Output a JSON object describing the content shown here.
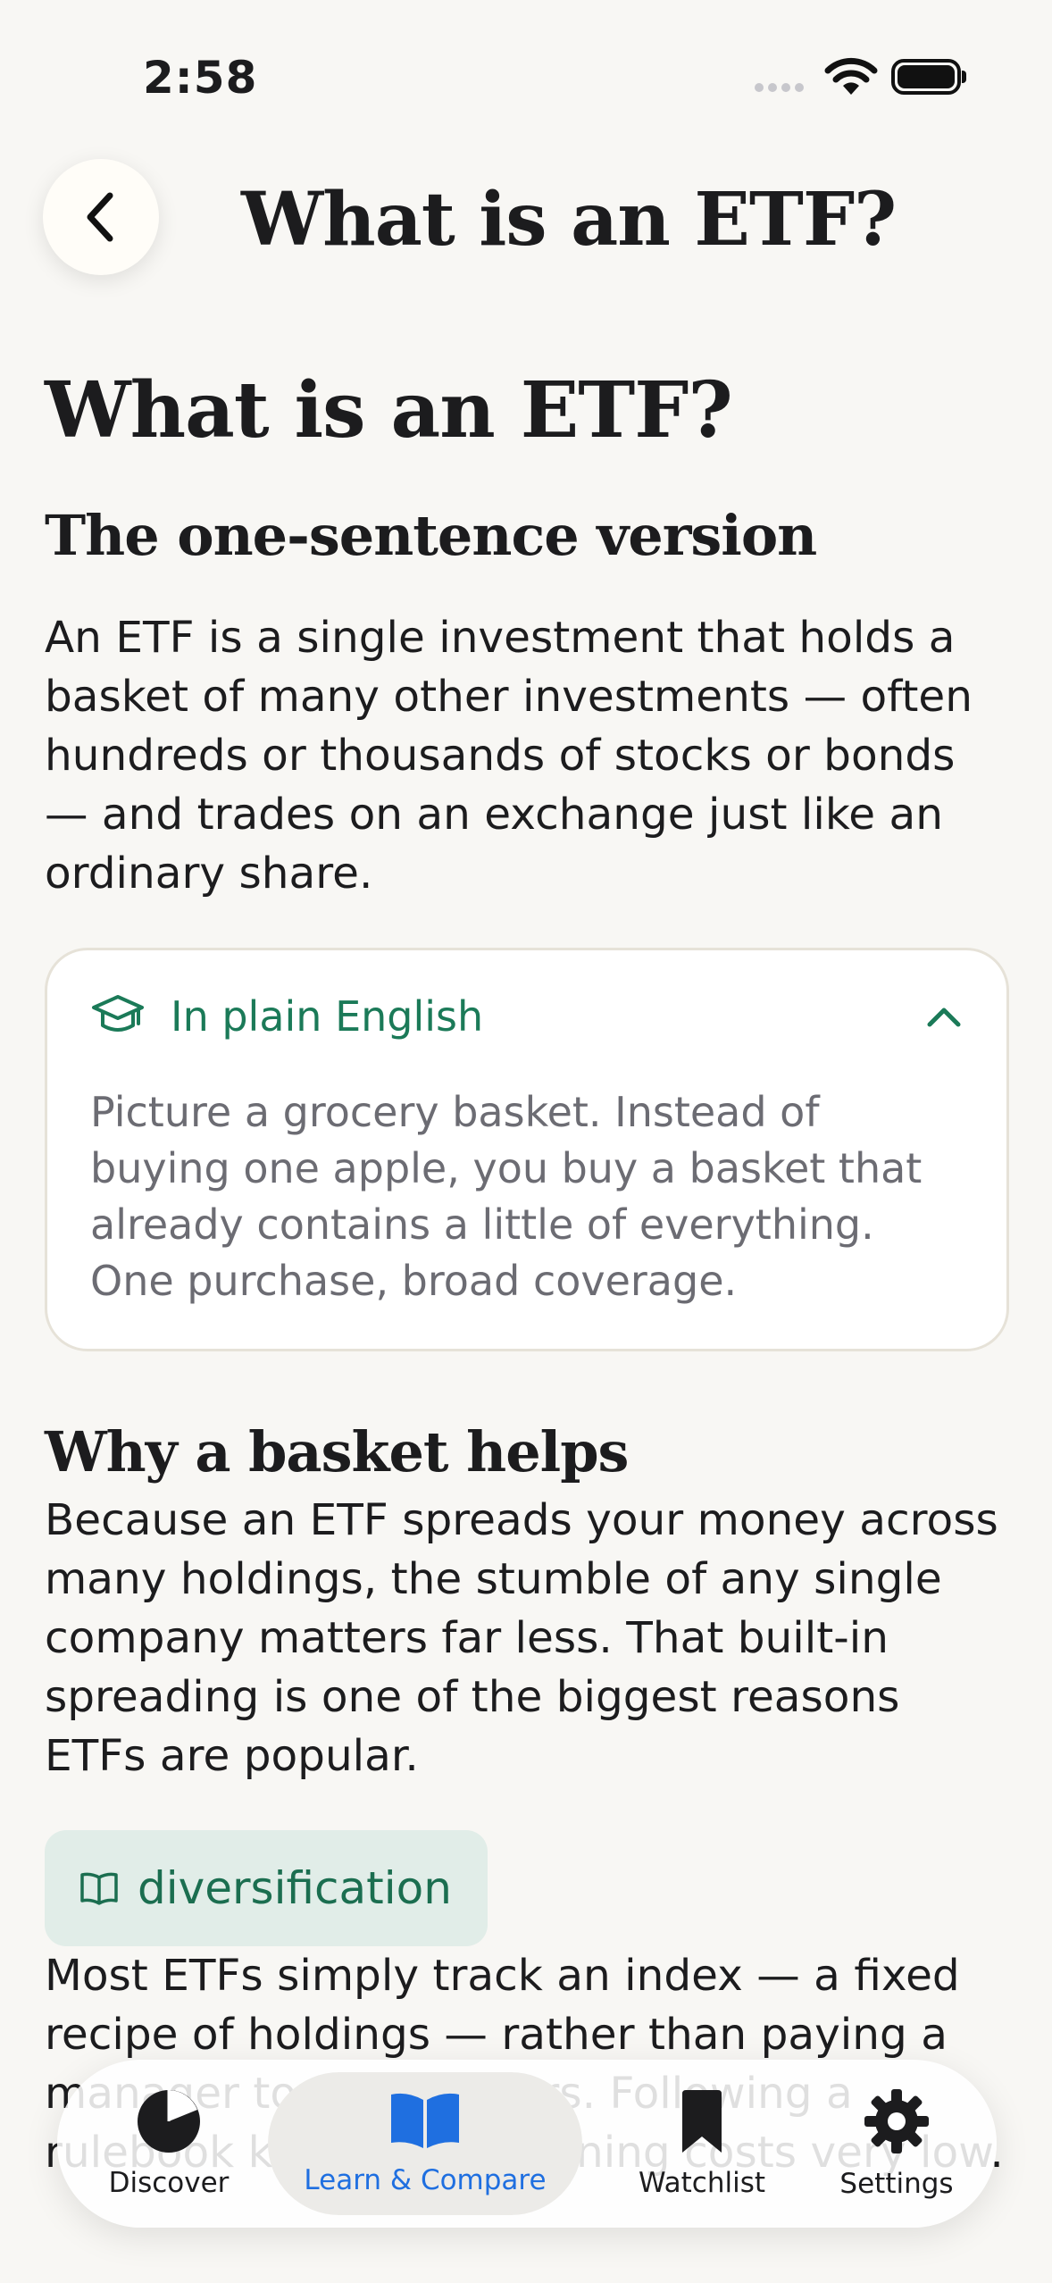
{
  "status": {
    "time": "2:58"
  },
  "nav": {
    "title": "What is an ETF?"
  },
  "article": {
    "title": "What is an ETF?",
    "sections": [
      {
        "heading": "The one-sentence version",
        "body": "An ETF is a single investment that holds a basket of many other investments — often hundreds or thousands of stocks or bonds — and trades on an exchange just like an ordinary share."
      },
      {
        "heading": "Why a basket helps",
        "body": "Because an ETF spreads your money across many holdings, the stumble of any single company matters far less. That built-in spreading is one of the biggest reasons ETFs are popular."
      }
    ],
    "plain_english": {
      "label": "In plain English",
      "text": "Picture a grocery basket. Instead of buying one apple, you buy a basket that already contains a little of everything. One purchase, broad coverage."
    },
    "glossary_chip": "diversification",
    "faded_text": "Most ETFs simply track an index — a fixed recipe of holdings — rather than paying a manager to pick winners. Following a rulebook keeps their running costs very low."
  },
  "tabbar": {
    "tabs": [
      {
        "label": "Discover",
        "icon": "pie-chart-icon"
      },
      {
        "label": "Learn & Compare",
        "icon": "open-book-icon"
      },
      {
        "label": "Watchlist",
        "icon": "bookmark-icon"
      },
      {
        "label": "Settings",
        "icon": "gear-icon"
      }
    ],
    "active_color": "#1f6fe0"
  },
  "colors": {
    "accent_green": "#1b7a58",
    "background": "#f8f7f4"
  }
}
